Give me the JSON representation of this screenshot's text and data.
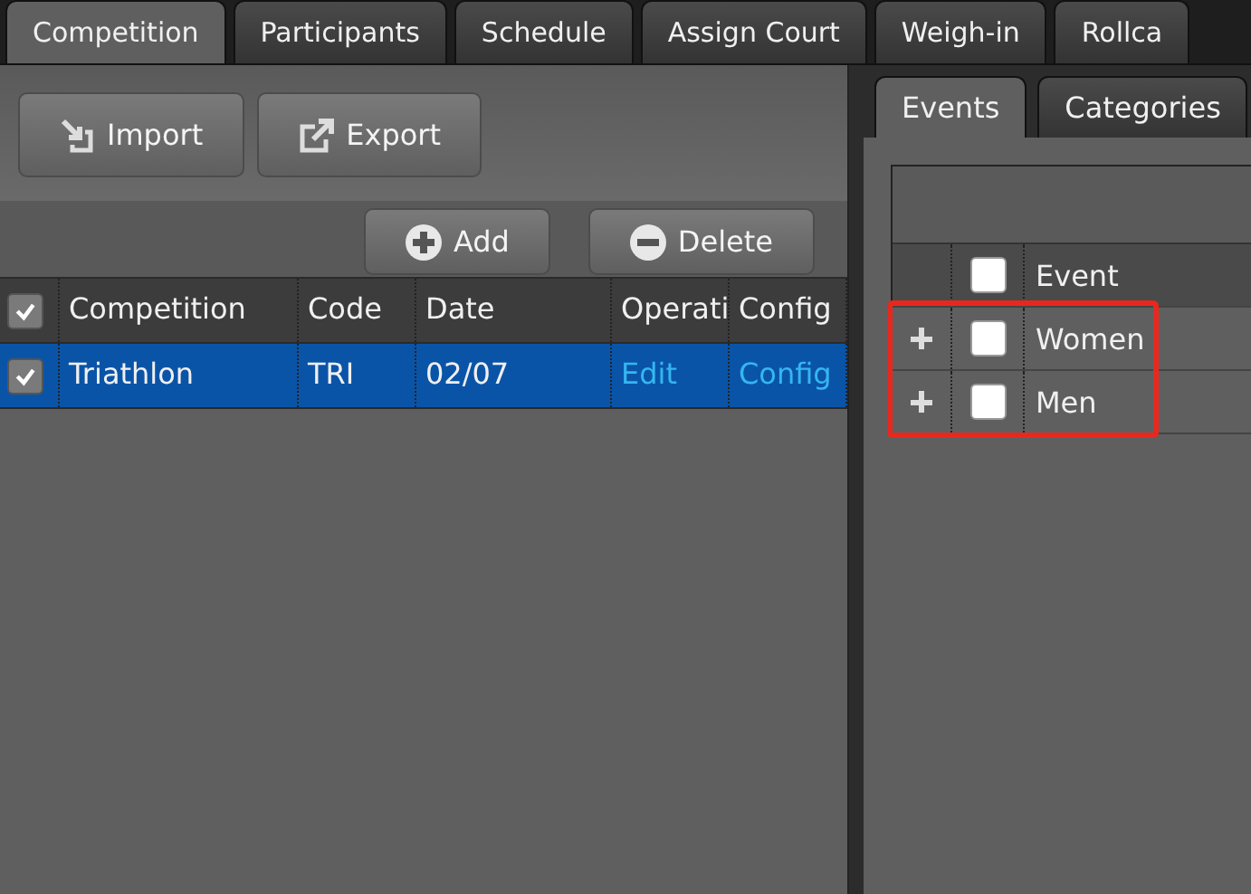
{
  "top_tabs": [
    {
      "label": "Competition",
      "selected": true
    },
    {
      "label": "Participants",
      "selected": false
    },
    {
      "label": "Schedule",
      "selected": false
    },
    {
      "label": "Assign Court",
      "selected": false
    },
    {
      "label": "Weigh-in",
      "selected": false
    },
    {
      "label": "Rollca",
      "selected": false
    }
  ],
  "toolbar": [
    {
      "label": "Import",
      "kind": "import"
    },
    {
      "label": "Export",
      "kind": "export"
    }
  ],
  "grid_actions": [
    {
      "label": "Add",
      "kind": "add"
    },
    {
      "label": "Delete",
      "kind": "delete"
    }
  ],
  "competition_table": {
    "all_checked": true,
    "columns": [
      "Competition",
      "Code",
      "Date",
      "Operati",
      "Config"
    ],
    "rows": [
      {
        "checked": true,
        "selected": true,
        "cells": [
          "Triathlon",
          "TRI",
          "02/07"
        ],
        "links": [
          "Edit",
          "Config"
        ]
      }
    ]
  },
  "side_tabs": [
    {
      "label": "Events",
      "selected": true
    },
    {
      "label": "Categories",
      "selected": false
    }
  ],
  "events_table": {
    "all_checked": false,
    "column": "Event",
    "highlighted": true,
    "rows": [
      {
        "label": "Women",
        "checked": false,
        "expanded": false
      },
      {
        "label": "Men",
        "checked": false,
        "expanded": false
      }
    ]
  }
}
